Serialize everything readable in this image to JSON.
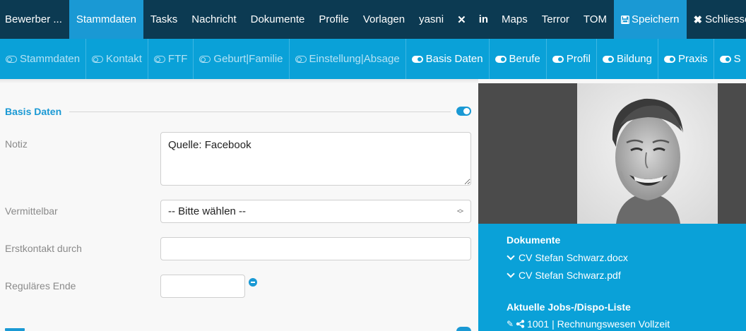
{
  "topnav": {
    "items": [
      {
        "label": "Bewerber ..."
      },
      {
        "label": "Stammdaten",
        "active": true
      },
      {
        "label": "Tasks"
      },
      {
        "label": "Nachricht"
      },
      {
        "label": "Dokumente"
      },
      {
        "label": "Profile"
      },
      {
        "label": "Vorlagen"
      },
      {
        "label": "yasni"
      },
      {
        "icon": "xing-icon",
        "glyph": "✕"
      },
      {
        "icon": "linkedin-icon",
        "glyph": "in"
      },
      {
        "label": "Maps"
      },
      {
        "label": "Terror"
      },
      {
        "label": "TOM"
      },
      {
        "label": "Speichern",
        "icon": "save-icon"
      },
      {
        "label": "Schliessen",
        "icon": "close-icon"
      }
    ]
  },
  "subnav": {
    "tabs": [
      {
        "label": "Stammdaten",
        "enabled": false
      },
      {
        "label": "Kontakt",
        "enabled": false
      },
      {
        "label": "FTF",
        "enabled": false
      },
      {
        "label": "Geburt|Familie",
        "enabled": false
      },
      {
        "label": "Einstellung|Absage",
        "enabled": false
      },
      {
        "label": "Basis Daten",
        "enabled": true
      },
      {
        "label": "Berufe",
        "enabled": true
      },
      {
        "label": "Profil",
        "enabled": true
      },
      {
        "label": "Bildung",
        "enabled": true
      },
      {
        "label": "Praxis",
        "enabled": true
      },
      {
        "label": "S",
        "enabled": true
      }
    ]
  },
  "section": {
    "title": "Basis Daten",
    "enabled": true
  },
  "form": {
    "notiz": {
      "label": "Notiz",
      "value": "Quelle: Facebook"
    },
    "vermittelbar": {
      "label": "Vermittelbar",
      "value": "-- Bitte wählen --"
    },
    "erstkontakt": {
      "label": "Erstkontakt durch",
      "value": ""
    },
    "regulaeres_ende": {
      "label": "Reguläres Ende",
      "value": ""
    }
  },
  "panel": {
    "documents_title": "Dokumente",
    "documents": [
      "CV Stefan Schwarz.docx",
      "CV Stefan Schwarz.pdf"
    ],
    "jobs_title": "Aktuelle Jobs-/Dispo-Liste",
    "jobs": [
      "1001 | Rechnungswesen Vollzeit"
    ]
  },
  "colors": {
    "nav_dark": "#0c3a52",
    "accent": "#1a99d4",
    "subnav": "#0aa1d8"
  }
}
